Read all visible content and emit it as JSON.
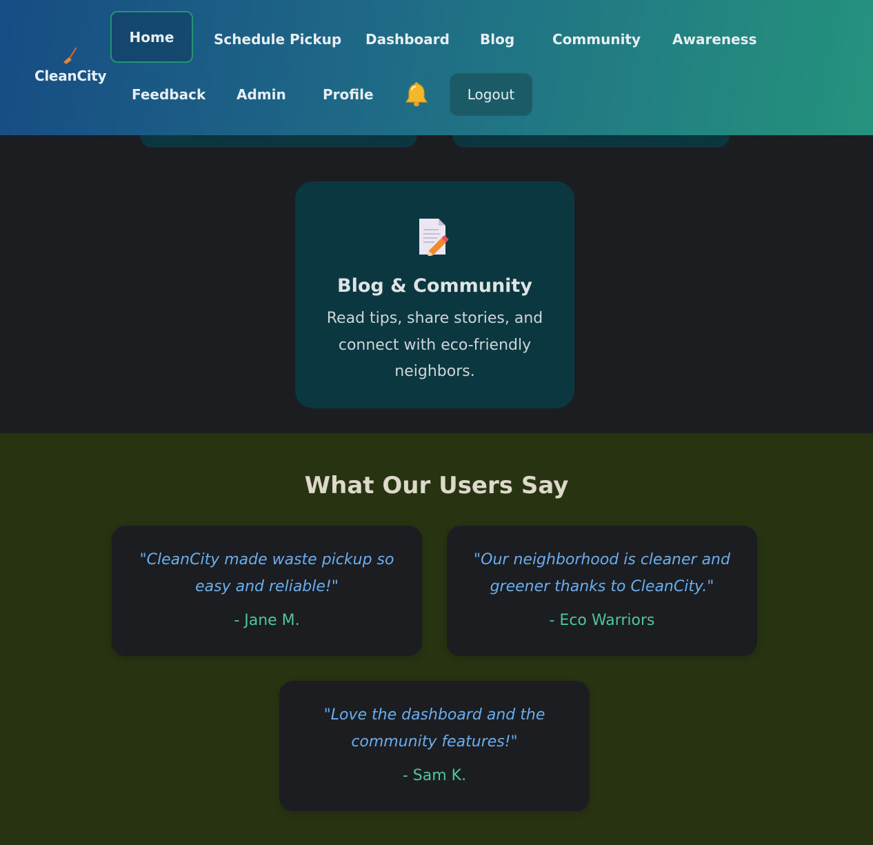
{
  "brand": {
    "name": "CleanCity",
    "icon": "broom-icon"
  },
  "nav": {
    "items": [
      {
        "label": "Home",
        "active": true
      },
      {
        "label": "Schedule Pickup"
      },
      {
        "label": "Dashboard"
      },
      {
        "label": "Blog"
      },
      {
        "label": "Community"
      },
      {
        "label": "Awareness"
      },
      {
        "label": "Feedback"
      },
      {
        "label": "Admin"
      },
      {
        "label": "Profile"
      }
    ],
    "notification_icon": "bell-icon",
    "logout_label": "Logout"
  },
  "features": {
    "card": {
      "icon": "memo-pencil-icon",
      "title": "Blog & Community",
      "description": "Read tips, share stories, and connect with eco-friendly neighbors."
    }
  },
  "testimonials": {
    "heading": "What Our Users Say",
    "items": [
      {
        "quote": "\"CleanCity made waste pickup so easy and reliable!\"",
        "author": "- Jane M."
      },
      {
        "quote": "\"Our neighborhood is cleaner and greener thanks to CleanCity.\"",
        "author": "- Eco Warriors"
      },
      {
        "quote": "\"Love the dashboard and the community features!\"",
        "author": "- Sam K."
      }
    ]
  },
  "colors": {
    "header_gradient_start": "#174c84",
    "header_gradient_end": "#25937d",
    "active_border": "#23966f",
    "feature_card": "#0b3740",
    "testimonial_bg": "#283312",
    "quote_text": "#6aaef0",
    "author_text": "#4fc79a"
  }
}
